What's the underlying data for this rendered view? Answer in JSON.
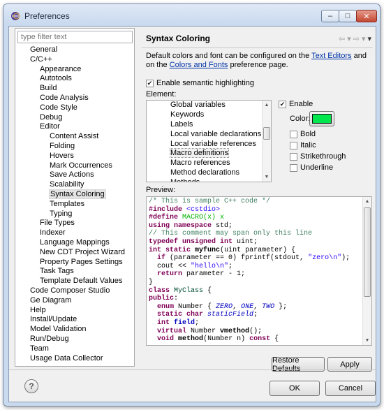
{
  "window": {
    "title": "Preferences"
  },
  "filter": {
    "placeholder": "type filter text"
  },
  "tree": [
    {
      "label": "General",
      "level": 0
    },
    {
      "label": "C/C++",
      "level": 0
    },
    {
      "label": "Appearance",
      "level": 1
    },
    {
      "label": "Autotools",
      "level": 1
    },
    {
      "label": "Build",
      "level": 1
    },
    {
      "label": "Code Analysis",
      "level": 1
    },
    {
      "label": "Code Style",
      "level": 1
    },
    {
      "label": "Debug",
      "level": 1
    },
    {
      "label": "Editor",
      "level": 1
    },
    {
      "label": "Content Assist",
      "level": 2
    },
    {
      "label": "Folding",
      "level": 2
    },
    {
      "label": "Hovers",
      "level": 2
    },
    {
      "label": "Mark Occurrences",
      "level": 2
    },
    {
      "label": "Save Actions",
      "level": 2
    },
    {
      "label": "Scalability",
      "level": 2
    },
    {
      "label": "Syntax Coloring",
      "level": 2,
      "selected": true
    },
    {
      "label": "Templates",
      "level": 2
    },
    {
      "label": "Typing",
      "level": 2
    },
    {
      "label": "File Types",
      "level": 1
    },
    {
      "label": "Indexer",
      "level": 1
    },
    {
      "label": "Language Mappings",
      "level": 1
    },
    {
      "label": "New CDT Project Wizard",
      "level": 1
    },
    {
      "label": "Property Pages Settings",
      "level": 1
    },
    {
      "label": "Task Tags",
      "level": 1
    },
    {
      "label": "Template Default Values",
      "level": 1
    },
    {
      "label": "Code Composer Studio",
      "level": 0
    },
    {
      "label": "Ge Diagram",
      "level": 0
    },
    {
      "label": "Help",
      "level": 0
    },
    {
      "label": "Install/Update",
      "level": 0
    },
    {
      "label": "Model Validation",
      "level": 0
    },
    {
      "label": "Run/Debug",
      "level": 0
    },
    {
      "label": "Team",
      "level": 0
    },
    {
      "label": "Usage Data Collector",
      "level": 0
    }
  ],
  "page": {
    "title": "Syntax Coloring",
    "desc_part1": "Default colors and font can be configured on the ",
    "desc_link1": "Text Editors",
    "desc_part2": " and on the ",
    "desc_link2": "Colors and Fonts",
    "desc_part3": " preference page.",
    "semantic_label": "Enable semantic highlighting",
    "semantic_checked": true,
    "element_label": "Element:",
    "preview_label": "Preview:"
  },
  "elements": [
    {
      "label": "Global variables"
    },
    {
      "label": "Keywords"
    },
    {
      "label": "Labels"
    },
    {
      "label": "Local variable declarations"
    },
    {
      "label": "Local variable references"
    },
    {
      "label": "Macro definitions",
      "selected": true
    },
    {
      "label": "Macro references"
    },
    {
      "label": "Method declarations"
    },
    {
      "label": "Methods"
    }
  ],
  "options": {
    "enable_label": "Enable",
    "enable_checked": true,
    "color_label": "Color:",
    "color_value": "#00e64d",
    "bold_label": "Bold",
    "italic_label": "Italic",
    "strike_label": "Strikethrough",
    "underline_label": "Underline"
  },
  "buttons": {
    "restore": "Restore Defaults",
    "apply": "Apply",
    "ok": "OK",
    "cancel": "Cancel"
  },
  "code": [
    [
      {
        "t": "/* This is sample C++ code */",
        "c": "cm"
      }
    ],
    [
      {
        "t": "#include ",
        "c": "pp"
      },
      {
        "t": "<cstdio>",
        "c": "st"
      }
    ],
    [
      {
        "t": "#define ",
        "c": "pp"
      },
      {
        "t": "MACRO(x) x",
        "c": "mac"
      }
    ],
    [
      {
        "t": "using namespace",
        "c": "kw"
      },
      {
        "t": " std;"
      }
    ],
    [
      {
        "t": "// This comment may span only this line",
        "c": "cm"
      }
    ],
    [
      {
        "t": "typedef unsigned int",
        "c": "kw"
      },
      {
        "t": " uint;"
      }
    ],
    [
      {
        "t": "int static",
        "c": "kw"
      },
      {
        "t": " "
      },
      {
        "t": "myfunc",
        "c": "fn"
      },
      {
        "t": "("
      },
      {
        "t": "uint",
        "c": ""
      },
      {
        "t": " parameter) {"
      }
    ],
    [
      {
        "t": "  "
      },
      {
        "t": "if",
        "c": "kw"
      },
      {
        "t": " (parameter == 0) fprintf(stdout, "
      },
      {
        "t": "\"zero\\n\"",
        "c": "st"
      },
      {
        "t": ");"
      }
    ],
    [
      {
        "t": "  cout << "
      },
      {
        "t": "\"hello\\n\"",
        "c": "st"
      },
      {
        "t": ";"
      }
    ],
    [
      {
        "t": "  "
      },
      {
        "t": "return",
        "c": "kw"
      },
      {
        "t": " parameter - 1;"
      }
    ],
    [
      {
        "t": "}"
      }
    ],
    [
      {
        "t": "class",
        "c": "kw"
      },
      {
        "t": " "
      },
      {
        "t": "MyClass",
        "c": "cls"
      },
      {
        "t": " {"
      }
    ],
    [
      {
        "t": "public",
        "c": "kw"
      },
      {
        "t": ":"
      }
    ],
    [
      {
        "t": "  "
      },
      {
        "t": "enum",
        "c": "kw"
      },
      {
        "t": " Number { "
      },
      {
        "t": "ZERO",
        "c": "enm"
      },
      {
        "t": ", "
      },
      {
        "t": "ONE",
        "c": "enm"
      },
      {
        "t": ", "
      },
      {
        "t": "TWO",
        "c": "enm"
      },
      {
        "t": " };"
      }
    ],
    [
      {
        "t": "  "
      },
      {
        "t": "static char",
        "c": "kw"
      },
      {
        "t": " "
      },
      {
        "t": "staticField",
        "c": "it"
      },
      {
        "t": ";"
      }
    ],
    [
      {
        "t": "  "
      },
      {
        "t": "int",
        "c": "kw"
      },
      {
        "t": " "
      },
      {
        "t": "field",
        "c": "field"
      },
      {
        "t": ";"
      }
    ],
    [
      {
        "t": "  "
      },
      {
        "t": "virtual",
        "c": "kw"
      },
      {
        "t": " Number "
      },
      {
        "t": "vmethod",
        "c": "fn"
      },
      {
        "t": "();"
      }
    ],
    [
      {
        "t": "  "
      },
      {
        "t": "void",
        "c": "kw"
      },
      {
        "t": " "
      },
      {
        "t": "method",
        "c": "fn"
      },
      {
        "t": "(Number n) "
      },
      {
        "t": "const",
        "c": "kw"
      },
      {
        "t": " {"
      }
    ]
  ]
}
